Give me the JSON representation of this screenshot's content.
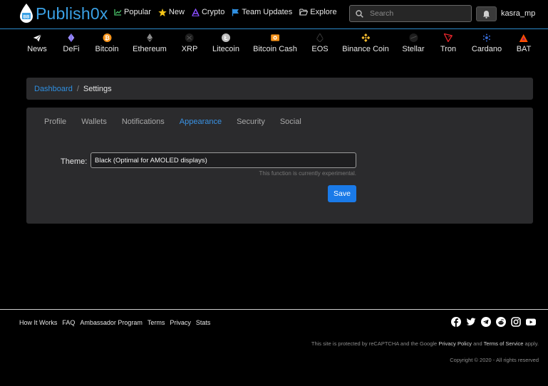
{
  "brand": {
    "name": "Publish0x"
  },
  "nav": {
    "links": [
      {
        "label": "Popular",
        "icon": "chart-line-icon",
        "color": "#49c46a"
      },
      {
        "label": "New",
        "icon": "star-icon",
        "color": "#f5c518"
      },
      {
        "label": "Crypto",
        "icon": "crypto-a-icon",
        "color": "#8a4dff"
      },
      {
        "label": "Team Updates",
        "icon": "flag-icon",
        "color": "#2f8fe0"
      },
      {
        "label": "Explore",
        "icon": "folder-open-icon",
        "color": "#e0e0e0"
      }
    ],
    "search_placeholder": "Search",
    "username": "kasra_mp"
  },
  "coins": [
    {
      "label": "News",
      "icon": "paper-plane-icon",
      "color": "#ffffff"
    },
    {
      "label": "DeFi",
      "icon": "defi-icon",
      "color": "#9b8cff"
    },
    {
      "label": "Bitcoin",
      "icon": "bitcoin-icon",
      "color": "#f7931a"
    },
    {
      "label": "Ethereum",
      "icon": "ethereum-icon",
      "color": "#8c8c8c"
    },
    {
      "label": "XRP",
      "icon": "xrp-icon",
      "color": "#1e1e1e"
    },
    {
      "label": "Litecoin",
      "icon": "litecoin-icon",
      "color": "#bfbfbf"
    },
    {
      "label": "Bitcoin Cash",
      "icon": "bitcoin-cash-icon",
      "color": "#f7931a"
    },
    {
      "label": "EOS",
      "icon": "eos-icon",
      "color": "#2a2a2a"
    },
    {
      "label": "Binance Coin",
      "icon": "binance-icon",
      "color": "#f3ba2f"
    },
    {
      "label": "Stellar",
      "icon": "stellar-icon",
      "color": "#1e1e1e"
    },
    {
      "label": "Tron",
      "icon": "tron-icon",
      "color": "#e5252b"
    },
    {
      "label": "Cardano",
      "icon": "cardano-icon",
      "color": "#3468d1"
    },
    {
      "label": "BAT",
      "icon": "bat-icon",
      "color": "#ff5000"
    }
  ],
  "breadcrumb": {
    "parent": "Dashboard",
    "current": "Settings"
  },
  "settings": {
    "tabs": [
      {
        "label": "Profile",
        "active": false
      },
      {
        "label": "Wallets",
        "active": false
      },
      {
        "label": "Notifications",
        "active": false
      },
      {
        "label": "Appearance",
        "active": true
      },
      {
        "label": "Security",
        "active": false
      },
      {
        "label": "Social",
        "active": false
      }
    ],
    "theme_label": "Theme:",
    "theme_value": "Black (Optimal for AMOLED displays)",
    "helper_text": "This function is currently experimental.",
    "save_label": "Save"
  },
  "footer": {
    "links": [
      "How It Works",
      "FAQ",
      "Ambassador Program",
      "Terms",
      "Privacy",
      "Stats"
    ],
    "social": [
      "facebook-icon",
      "twitter-icon",
      "telegram-icon",
      "reddit-icon",
      "instagram-icon",
      "youtube-icon"
    ],
    "legal_prefix": "This site is protected by reCAPTCHA and the Google",
    "privacy_policy": "Privacy Policy",
    "legal_and": "and",
    "terms_of_service": "Terms of Service",
    "legal_suffix": "apply.",
    "copyright": "Copyright © 2020 - All rights reserved"
  },
  "colors": {
    "accent": "#2f8fe0",
    "button": "#1a7ae8",
    "panel": "#2b2b2d",
    "background": "#000000"
  }
}
